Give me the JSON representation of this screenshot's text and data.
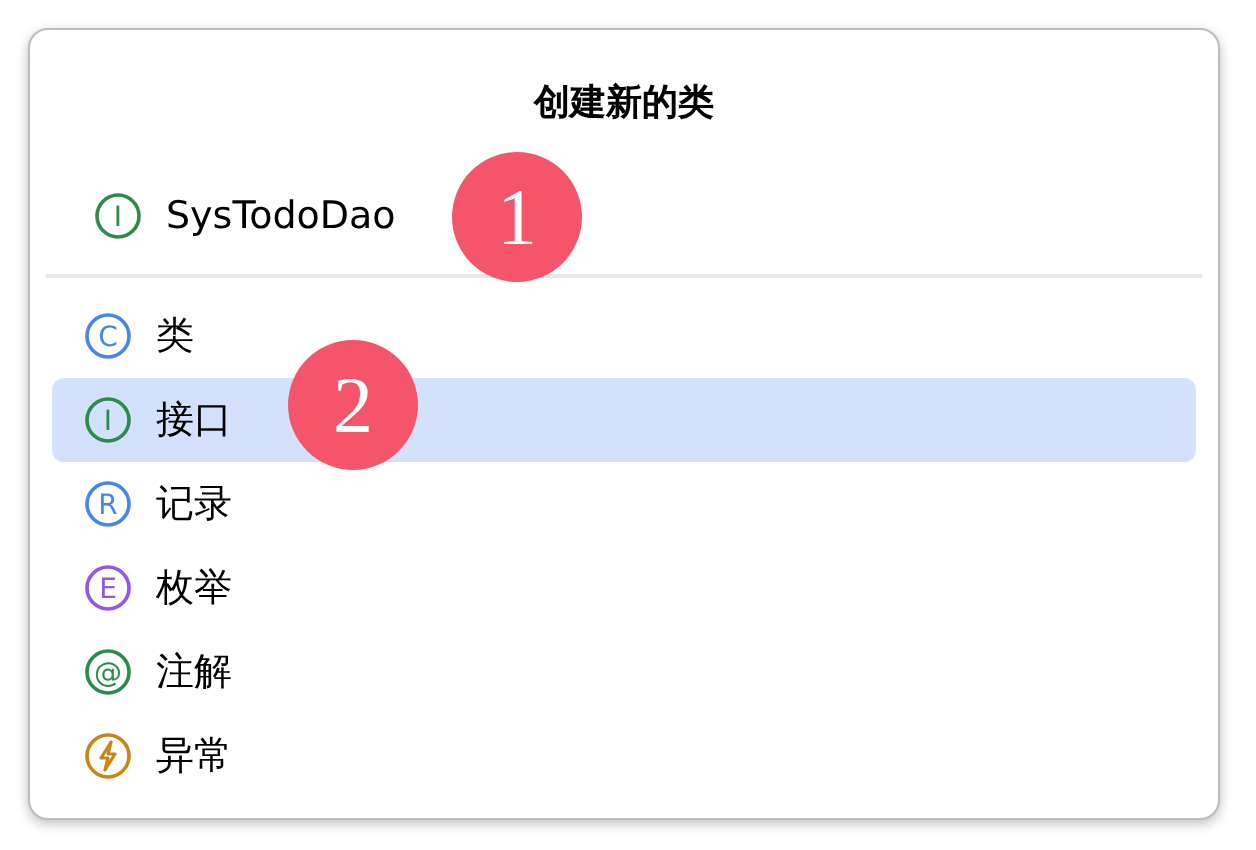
{
  "dialog": {
    "title": "创建新的类"
  },
  "name_field": {
    "value": "SysTodoDao",
    "glyph": "I",
    "color": "#2e8b4e"
  },
  "items": [
    {
      "label": "类",
      "kind": "letter",
      "glyph": "C",
      "color": "#4a86e8",
      "selected": false
    },
    {
      "label": "接口",
      "kind": "letter",
      "glyph": "I",
      "color": "#2e8b4e",
      "selected": true
    },
    {
      "label": "记录",
      "kind": "letter",
      "glyph": "R",
      "color": "#4a86e8",
      "selected": false
    },
    {
      "label": "枚举",
      "kind": "letter",
      "glyph": "E",
      "color": "#9457e8",
      "selected": false
    },
    {
      "label": "注解",
      "kind": "letter",
      "glyph": "@",
      "color": "#2e8b4e",
      "selected": false
    },
    {
      "label": "异常",
      "kind": "bolt",
      "color": "#c98516",
      "selected": false
    }
  ],
  "callouts": [
    {
      "number": "1"
    },
    {
      "number": "2"
    }
  ]
}
